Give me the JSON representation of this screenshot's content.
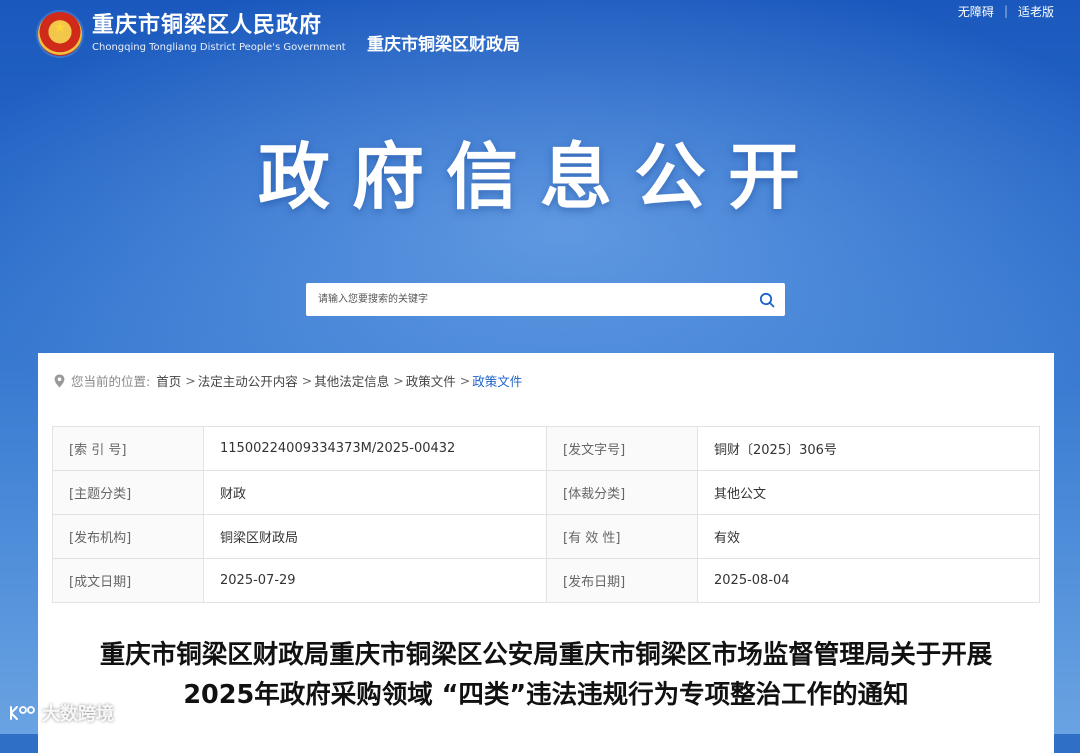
{
  "topbar": {
    "accessibility": "无障碍",
    "separator": "|",
    "elderly": "适老版"
  },
  "header": {
    "site_name_cn": "重庆市铜梁区人民政府",
    "site_name_en": "Chongqing Tongliang District People's Government",
    "dept_name": "重庆市铜梁区财政局"
  },
  "hero": {
    "title": "政府信息公开"
  },
  "search": {
    "placeholder": "请输入您要搜索的关键字"
  },
  "breadcrumb": {
    "prefix": "您当前的位置:",
    "items": [
      "首页",
      "法定主动公开内容",
      "其他法定信息",
      "政策文件",
      "政策文件"
    ]
  },
  "meta": {
    "rows": [
      {
        "k1": "[索 引 号]",
        "v1": "11500224009334373M/2025-00432",
        "k2": "[发文字号]",
        "v2": "铜财〔2025〕306号"
      },
      {
        "k1": "[主题分类]",
        "v1": "财政",
        "k2": "[体裁分类]",
        "v2": "其他公文"
      },
      {
        "k1": "[发布机构]",
        "v1": "铜梁区财政局",
        "k2": "[有 效 性]",
        "v2": "有效"
      },
      {
        "k1": "[成文日期]",
        "v1": "2025-07-29",
        "k2": "[发布日期]",
        "v2": "2025-08-04"
      }
    ]
  },
  "document": {
    "title_line1": "重庆市铜梁区财政局重庆市铜梁区公安局重庆市铜梁区市场监督管理局关于开展",
    "title_line2": "2025年政府采购领域 “四类”违法违规行为专项整治工作的通知"
  },
  "watermark": {
    "text": "大数跨境"
  }
}
